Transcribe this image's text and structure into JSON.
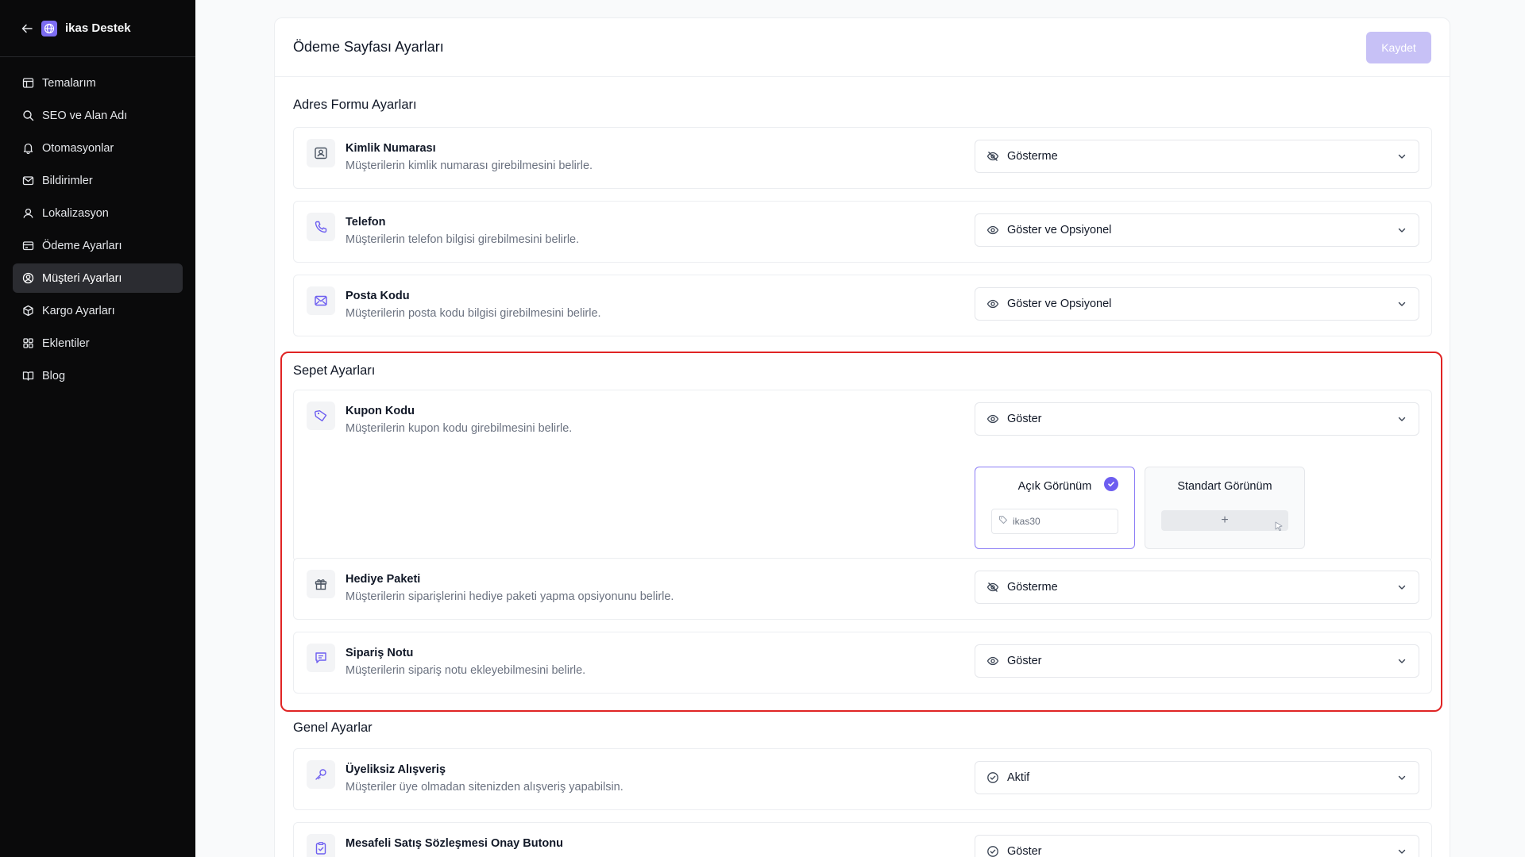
{
  "sidebar": {
    "brand": "ikas Destek",
    "items": [
      {
        "label": "Temalarım",
        "icon": "layout-icon"
      },
      {
        "label": "SEO ve Alan Adı",
        "icon": "search-icon"
      },
      {
        "label": "Otomasyonlar",
        "icon": "bell-icon"
      },
      {
        "label": "Bildirimler",
        "icon": "mail-icon"
      },
      {
        "label": "Lokalizasyon",
        "icon": "user-pin-icon"
      },
      {
        "label": "Ödeme Ayarları",
        "icon": "credit-card-icon"
      },
      {
        "label": "Müşteri Ayarları",
        "icon": "user-circle-icon",
        "active": true
      },
      {
        "label": "Kargo Ayarları",
        "icon": "box-icon"
      },
      {
        "label": "Eklentiler",
        "icon": "grid-icon"
      },
      {
        "label": "Blog",
        "icon": "book-icon"
      }
    ]
  },
  "header": {
    "title": "Ödeme Sayfası Ayarları",
    "save_label": "Kaydet"
  },
  "sections": {
    "address": {
      "title": "Adres Formu Ayarları",
      "rows": [
        {
          "title": "Kimlik Numarası",
          "desc": "Müşterilerin kimlik numarası girebilmesini belirle.",
          "value": "Gösterme",
          "icon": "id-card-icon",
          "value_icon": "eye-off-icon"
        },
        {
          "title": "Telefon",
          "desc": "Müşterilerin telefon bilgisi girebilmesini belirle.",
          "value": "Göster ve Opsiyonel",
          "icon": "phone-icon",
          "value_icon": "eye-icon"
        },
        {
          "title": "Posta Kodu",
          "desc": "Müşterilerin posta kodu bilgisi girebilmesini belirle.",
          "value": "Göster ve Opsiyonel",
          "icon": "envelope-icon",
          "value_icon": "eye-icon"
        }
      ]
    },
    "cart": {
      "title": "Sepet Ayarları",
      "rows": [
        {
          "title": "Kupon Kodu",
          "desc": "Müşterilerin kupon kodu girebilmesini belirle.",
          "value": "Göster",
          "icon": "tag-icon",
          "value_icon": "eye-icon"
        },
        {
          "title": "Hediye Paketi",
          "desc": "Müşterilerin siparişlerini hediye paketi yapma opsiyonunu belirle.",
          "value": "Gösterme",
          "icon": "gift-icon",
          "value_icon": "eye-off-icon"
        },
        {
          "title": "Sipariş Notu",
          "desc": "Müşterilerin sipariş notu ekleyebilmesini belirle.",
          "value": "Göster",
          "icon": "message-icon",
          "value_icon": "eye-icon"
        }
      ],
      "view_options": {
        "open": {
          "label": "Açık Görünüm",
          "preview_text": "ikas30",
          "selected": true
        },
        "standard": {
          "label": "Standart Görünüm",
          "preview_text": "+"
        }
      }
    },
    "general": {
      "title": "Genel Ayarlar",
      "rows": [
        {
          "title": "Üyeliksiz Alışveriş",
          "desc": "Müşteriler üye olmadan sitenizden alışveriş yapabilsin.",
          "value": "Aktif",
          "icon": "key-icon",
          "value_icon": "check-circle-icon"
        },
        {
          "title": "Mesafeli Satış Sözleşmesi Onay Butonu",
          "desc": "",
          "value": "Göster",
          "icon": "clipboard-check-icon",
          "value_icon": "check-circle-icon"
        }
      ]
    }
  },
  "colors": {
    "accent": "#6d5ef0",
    "highlight": "#e02424",
    "sidebar_bg": "#0a0a0b"
  }
}
